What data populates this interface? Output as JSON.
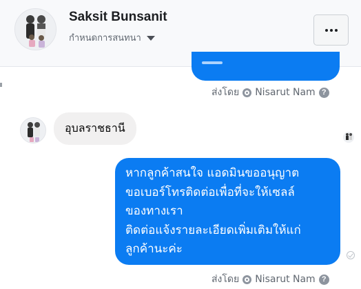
{
  "header": {
    "contact_name": "Saksit Bunsanit",
    "chat_settings_label": "กำหนดการสนทนา",
    "more_label": "..."
  },
  "messages": {
    "top_sent_by": {
      "prefix": "ส่งโดย",
      "name": "Nisarut Nam"
    },
    "incoming": {
      "text": "อุบลราชธานี"
    },
    "outgoing": {
      "lines": [
        "หากลูกค้าสนใจ แอดมินขออนุญาต",
        "ขอเบอร์โทรติดต่อเพื่อที่จะให้เซลล์",
        "ของทางเรา",
        "ติดต่อแจ้งรายละเอียดเพิ่มเติมให้แก่",
        "ลูกค้านะค่ะ"
      ]
    },
    "bottom_sent_by": {
      "prefix": "ส่งโดย",
      "name": "Nisarut Nam"
    }
  },
  "icons": {
    "more": "more-dots-icon",
    "caret": "caret-down-icon",
    "sender": "sender-ring-icon",
    "help": "help-icon",
    "seen": "seen-avatar-icon",
    "delivered": "delivered-check-icon"
  },
  "colors": {
    "outgoing_bubble": "#0b7cf2",
    "incoming_bubble": "#f1f0f0",
    "header_bg": "#f8f9fb"
  }
}
